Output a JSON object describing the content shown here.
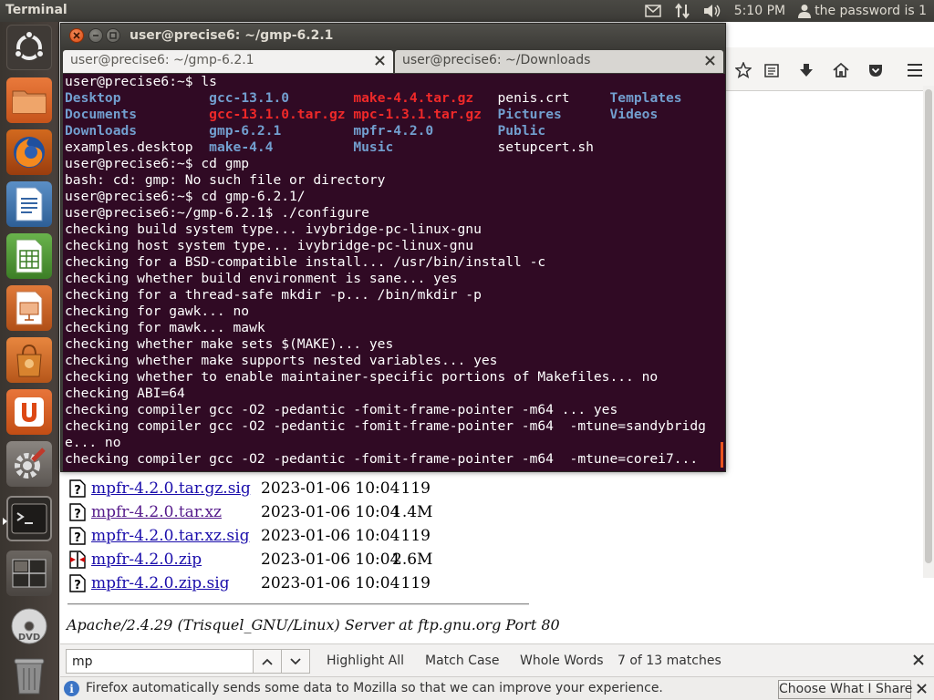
{
  "top_panel": {
    "app_title": "Terminal",
    "clock": "5:10 PM",
    "user_label": "the password is 1",
    "icons": [
      "mail-icon",
      "network-transfer-icon",
      "volume-icon",
      "user-icon"
    ]
  },
  "launcher": {
    "items": [
      {
        "name": "ubuntu-dash",
        "icon": "ubuntu-logo-icon"
      },
      {
        "name": "files",
        "icon": "folder-icon"
      },
      {
        "name": "firefox",
        "icon": "firefox-icon"
      },
      {
        "name": "writer",
        "icon": "libreoffice-writer-icon"
      },
      {
        "name": "calc",
        "icon": "libreoffice-calc-icon"
      },
      {
        "name": "impress",
        "icon": "libreoffice-impress-icon"
      },
      {
        "name": "software-center",
        "icon": "shopping-bag-icon"
      },
      {
        "name": "ubuntu-one",
        "icon": "ubuntu-one-icon"
      },
      {
        "name": "system-settings",
        "icon": "settings-icon"
      },
      {
        "name": "terminal",
        "icon": "terminal-icon"
      },
      {
        "name": "workspace-switcher",
        "icon": "workspace-icon"
      },
      {
        "name": "dvd",
        "icon": "dvd-icon",
        "label": "DVD"
      },
      {
        "name": "trash",
        "icon": "trash-icon"
      }
    ]
  },
  "terminal": {
    "title": "user@precise6: ~/gmp-6.2.1",
    "tabs": [
      {
        "label": "user@precise6: ~/gmp-6.2.1",
        "active": true
      },
      {
        "label": "user@precise6: ~/Downloads",
        "active": false
      }
    ],
    "ls_output": [
      [
        {
          "t": "Desktop",
          "c": "blue"
        },
        {
          "t": "gcc-13.1.0",
          "c": "blue"
        },
        {
          "t": "make-4.4.tar.gz",
          "c": "red"
        },
        {
          "t": "penis.crt",
          "c": "white"
        },
        {
          "t": "Templates",
          "c": "blue"
        }
      ],
      [
        {
          "t": "Documents",
          "c": "blue"
        },
        {
          "t": "gcc-13.1.0.tar.gz",
          "c": "red"
        },
        {
          "t": "mpc-1.3.1.tar.gz",
          "c": "red"
        },
        {
          "t": "Pictures",
          "c": "blue"
        },
        {
          "t": "Videos",
          "c": "blue"
        }
      ],
      [
        {
          "t": "Downloads",
          "c": "blue"
        },
        {
          "t": "gmp-6.2.1",
          "c": "blue"
        },
        {
          "t": "mpfr-4.2.0",
          "c": "blue"
        },
        {
          "t": "Public",
          "c": "blue"
        },
        {
          "t": "",
          "c": "white"
        }
      ],
      [
        {
          "t": "examples.desktop",
          "c": "white"
        },
        {
          "t": "make-4.4",
          "c": "blue"
        },
        {
          "t": "Music",
          "c": "blue"
        },
        {
          "t": "setupcert.sh",
          "c": "white"
        },
        {
          "t": "",
          "c": "white"
        }
      ]
    ],
    "lines_before": [
      "user@precise6:~$ ls"
    ],
    "lines_after": [
      "user@precise6:~$ cd gmp",
      "bash: cd: gmp: No such file or directory",
      "user@precise6:~$ cd gmp-6.2.1/",
      "user@precise6:~/gmp-6.2.1$ ./configure",
      "checking build system type... ivybridge-pc-linux-gnu",
      "checking host system type... ivybridge-pc-linux-gnu",
      "checking for a BSD-compatible install... /usr/bin/install -c",
      "checking whether build environment is sane... yes",
      "checking for a thread-safe mkdir -p... /bin/mkdir -p",
      "checking for gawk... no",
      "checking for mawk... mawk",
      "checking whether make sets $(MAKE)... yes",
      "checking whether make supports nested variables... yes",
      "checking whether to enable maintainer-specific portions of Makefiles... no",
      "checking ABI=64",
      "checking compiler gcc -O2 -pedantic -fomit-frame-pointer -m64 ... yes",
      "checking compiler gcc -O2 -pedantic -fomit-frame-pointer -m64  -mtune=sandybridg",
      "e... no",
      "checking compiler gcc -O2 -pedantic -fomit-frame-pointer -m64  -mtune=corei7..."
    ],
    "colors": {
      "background": "#300a24",
      "blue": "#729fcf",
      "red": "#ef2929",
      "text": "#ffffff"
    }
  },
  "firefox": {
    "toolbar_icons": [
      "bookmark-star-icon",
      "reading-list-icon",
      "download-icon",
      "home-icon",
      "pocket-icon",
      "menu-icon"
    ],
    "listing": [
      {
        "name": "mpfr-4.2.0.tar.gz.sig",
        "date": "2023-01-06 10:04",
        "size": "119",
        "icon": "unknown-file-icon",
        "visited": false
      },
      {
        "name": "mpfr-4.2.0.tar.xz",
        "date": "2023-01-06 10:04",
        "size": "1.4M",
        "icon": "unknown-file-icon",
        "visited": true
      },
      {
        "name": "mpfr-4.2.0.tar.xz.sig",
        "date": "2023-01-06 10:04",
        "size": "119",
        "icon": "unknown-file-icon",
        "visited": false
      },
      {
        "name": "mpfr-4.2.0.zip",
        "date": "2023-01-06 10:04",
        "size": "2.6M",
        "icon": "compressed-file-icon",
        "visited": false
      },
      {
        "name": "mpfr-4.2.0.zip.sig",
        "date": "2023-01-06 10:04",
        "size": "119",
        "icon": "unknown-file-icon",
        "visited": false
      }
    ],
    "server_signature": "Apache/2.4.29 (Trisquel_GNU/Linux) Server at ftp.gnu.org Port 80",
    "findbar": {
      "value": "mp",
      "highlight_all": "Highlight All",
      "match_case": "Match Case",
      "whole_words": "Whole Words",
      "count": "7 of 13 matches"
    },
    "notification": {
      "text": "Firefox automatically sends some data to Mozilla so that we can improve your experience.",
      "button": "Choose What I Share"
    }
  }
}
